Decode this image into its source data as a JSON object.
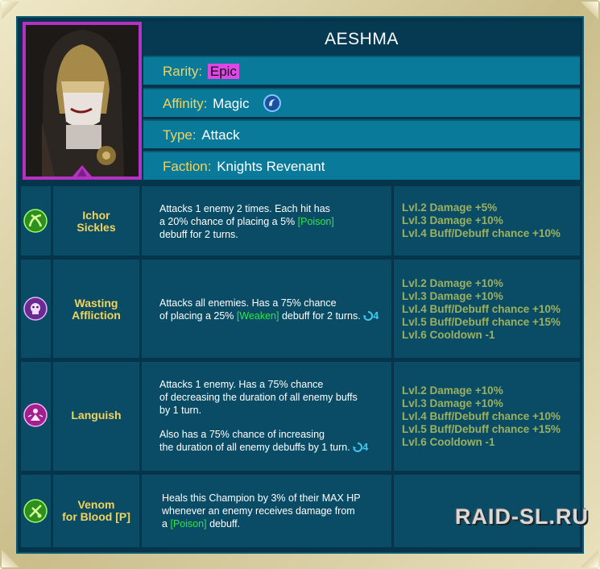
{
  "champion": {
    "name": "AESHMA",
    "rarity_label": "Rarity:",
    "rarity": "Epic",
    "affinity_label": "Affinity:",
    "affinity": "Magic",
    "type_label": "Type:",
    "type": "Attack",
    "faction_label": "Faction:",
    "faction": "Knights Revenant"
  },
  "colors": {
    "panel": "#05344b",
    "info_row": "#0a7a9b",
    "skill_cell": "#0a4c66",
    "gold_text": "#f3d35a",
    "epic": "#e046e6",
    "debuff_tag": "#2ee64a",
    "upgrade_text": "#9bb15f"
  },
  "skills": [
    {
      "icon": "ichor-sickles-icon",
      "name_line1": "Ichor",
      "name_line2": "Sickles",
      "desc": {
        "l1": "Attacks 1 enemy 2 times. Each hit has",
        "l2a": "a 20% chance of placing a 5% ",
        "l2tag": "[Poison]",
        "l3": "debuff for 2 turns."
      },
      "upgrades": [
        "Lvl.2 Damage +5%",
        "Lvl.3 Damage +10%",
        "Lvl.4 Buff/Debuff chance +10%"
      ]
    },
    {
      "icon": "wasting-affliction-icon",
      "name_line1": "Wasting",
      "name_line2": "Affliction",
      "desc": {
        "l1": "Attacks all enemies. Has a 75% chance",
        "l2a": "of placing a 25% ",
        "l2tag": "[Weaken]",
        "l2b": " debuff for 2 turns.",
        "cooldown": "4"
      },
      "upgrades": [
        "Lvl.2 Damage +10%",
        "Lvl.3 Damage +10%",
        "Lvl.4 Buff/Debuff chance +10%",
        "Lvl.5 Buff/Debuff chance +15%",
        "Lvl.6 Cooldown -1"
      ]
    },
    {
      "icon": "languish-icon",
      "name_line1": "Languish",
      "desc": {
        "l1": "Attacks 1 enemy. Has a 75% chance",
        "l2": "of decreasing the duration of all enemy buffs",
        "l3": "by 1 turn.",
        "l4": "Also has a 75% chance of increasing",
        "l5": "the duration of all enemy debuffs by 1 turn.",
        "cooldown": "4"
      },
      "upgrades": [
        "Lvl.2 Damage +10%",
        "Lvl.3 Damage +10%",
        "Lvl.4 Buff/Debuff chance +10%",
        "Lvl.5 Buff/Debuff chance +15%",
        "Lvl.6 Cooldown -1"
      ]
    },
    {
      "icon": "venom-for-blood-icon",
      "name_line1": "Venom",
      "name_line2": "for Blood [P]",
      "desc": {
        "l1": "Heals this Champion by 3% of their MAX HP",
        "l2": "whenever an enemy receives damage from",
        "l3a": "a ",
        "l3tag": "[Poison]",
        "l3b": " debuff."
      }
    }
  ],
  "watermark": "RAID-SL.RU"
}
